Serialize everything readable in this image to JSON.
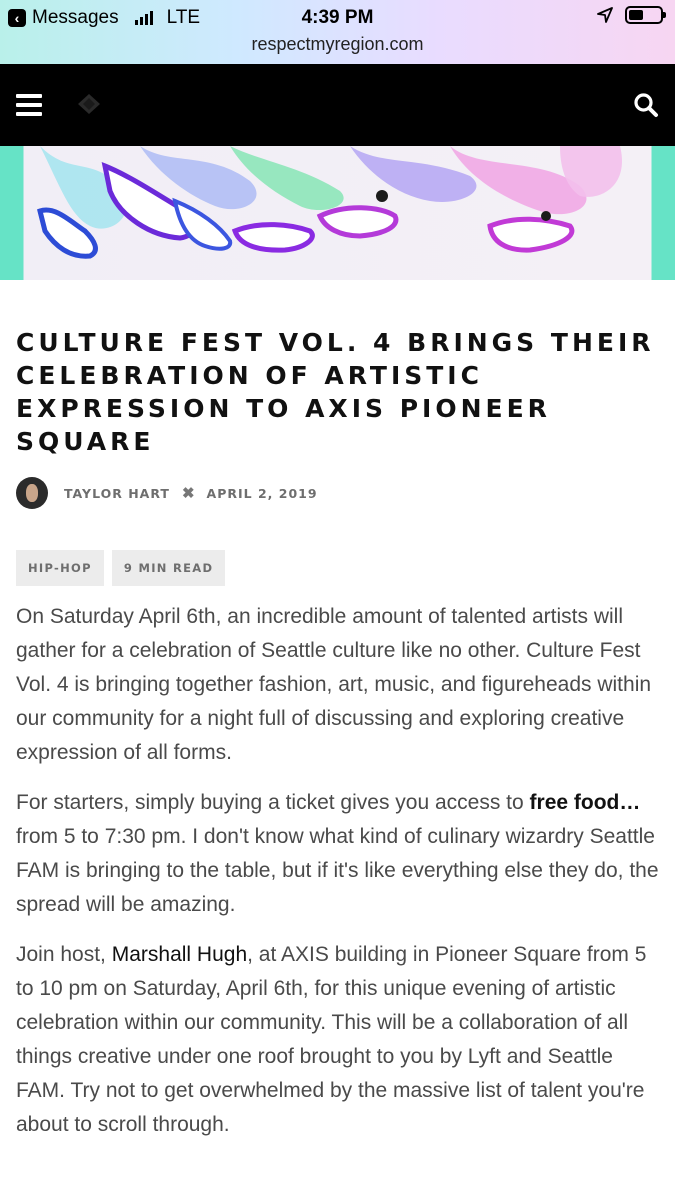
{
  "status_bar": {
    "back_app": "Messages",
    "carrier": "LTE",
    "time": "4:39 PM"
  },
  "browser": {
    "url": "respectmyregion.com"
  },
  "icons": {
    "menu": "hamburger-menu-icon",
    "logo": "site-logo-icon",
    "search": "search-icon",
    "meta_separator": "cross-icon"
  },
  "colors": {
    "nav_bg": "#000000",
    "hero_accent": "#66e3c6"
  },
  "article": {
    "title": "Culture Fest Vol. 4 Brings Their Celebration of Artistic Expression to AXIS Pioneer Square",
    "author": "Taylor Hart",
    "separator": "✖",
    "date": "April 2, 2019",
    "tags": [
      "Hip-Hop",
      "9 Min Read"
    ],
    "p1": "On Saturday April 6th, an incredible amount of talented artists will gather for a celebration of Seattle culture like no other. Culture Fest Vol. 4 is bringing together fashion, art, music, and figureheads within our community for a night full of discussing and exploring creative expression of all forms.",
    "p2_pre": "For starters, simply buying a ticket gives you access to ",
    "p2_bold": "free food…",
    "p2_post": " from 5 to 7:30 pm. I don't know what kind of culinary wizardry Seattle FAM is bringing to the table, but if it's like everything else they do, the spread will be amazing.",
    "p3_pre": "Join host, ",
    "p3_link": "Marshall Hugh",
    "p3_post": ", at AXIS building in Pioneer Square from 5 to 10 pm on Saturday, April 6th, for this unique evening of artistic celebration within our community. This will be a collaboration of all things creative under one roof brought to you by Lyft and Seattle FAM. Try not to get overwhelmed by the massive list of talent you're about to scroll through."
  }
}
